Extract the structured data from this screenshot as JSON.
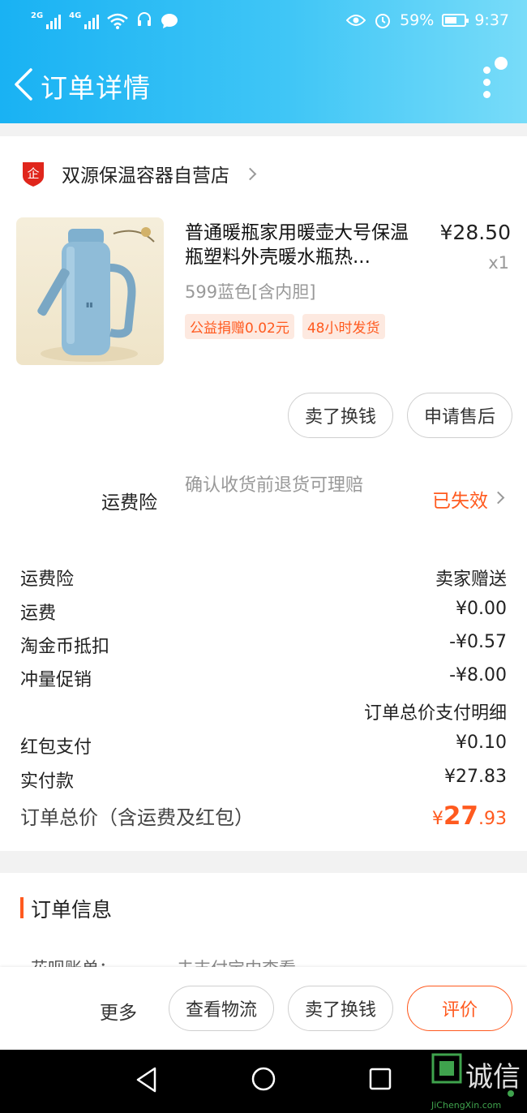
{
  "status_bar": {
    "net1": "2G",
    "net2": "4G",
    "battery": "59%",
    "time": "9:37"
  },
  "header": {
    "title": "订单详情"
  },
  "shop": {
    "name": "双源保温容器自营店",
    "logo_text": "企"
  },
  "product": {
    "title": "普通暖瓶家用暖壶大号保温瓶塑料外壳暖水瓶热...",
    "price": "¥28.50",
    "quantity": "x1",
    "sku": "599蓝色[含内胆]",
    "tags": [
      "公益捐赠0.02元",
      "48小时发货"
    ],
    "actions": [
      "卖了换钱",
      "申请售后"
    ]
  },
  "shipping_insurance": {
    "label": "运费险",
    "desc": "确认收货前退货可理赔",
    "status": "已失效"
  },
  "fees": [
    {
      "label": "运费险",
      "value": "卖家赠送"
    },
    {
      "label": "运费",
      "value": "¥0.00"
    },
    {
      "label": "淘金币抵扣",
      "value": "-¥0.57"
    },
    {
      "label": "冲量促销",
      "value": "-¥8.00"
    },
    {
      "label": "",
      "value": "订单总价支付明细"
    },
    {
      "label": "红包支付",
      "value": "¥0.10"
    },
    {
      "label": "实付款",
      "value": "¥27.83"
    }
  ],
  "total": {
    "label": "订单总价（含运费及红包）",
    "currency": "¥",
    "int": "27",
    "dec": ".93"
  },
  "order_info": {
    "title": "订单信息",
    "peek_label": "花呗账单：",
    "peek_value": "去支付宝中查看"
  },
  "bottom_actions": {
    "more": "更多",
    "logistics": "查看物流",
    "sell": "卖了换钱",
    "review": "评价"
  },
  "watermark": {
    "text": "诚信",
    "sub": "JiChengXin.com"
  },
  "colors": {
    "accent": "#ff5a1f",
    "header_start": "#19b2f3",
    "header_end": "#78dcf9"
  }
}
